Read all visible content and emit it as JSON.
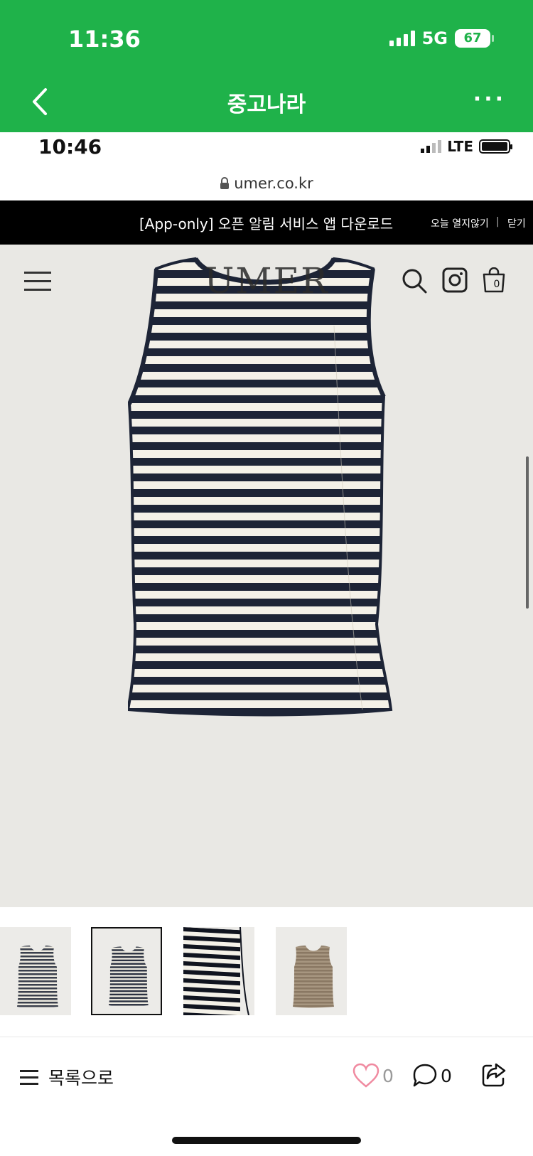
{
  "outer_status": {
    "time": "11:36",
    "network": "5G",
    "battery": "67"
  },
  "app_bar": {
    "title": "중고나라",
    "more": "···"
  },
  "inner_status": {
    "time": "10:46",
    "network": "LTE"
  },
  "browser": {
    "url": "umer.co.kr"
  },
  "promo": {
    "text": "[App-only] 오픈 알림 서비스 앱 다운로드",
    "dont_show_today": "오늘 열지않기",
    "separator": "|",
    "close": "닫기"
  },
  "site": {
    "logo": "UMER",
    "cart_count": "0"
  },
  "product": {
    "main_image": "striped-sleeveless-tank-top",
    "thumbnails": [
      "navy-stripe-tank-front",
      "navy-stripe-tank-front-selected",
      "navy-stripe-fabric-detail",
      "brown-stripe-tank-front"
    ],
    "selected_thumbnail_index": 1
  },
  "bottom_bar": {
    "list_label": "목록으로",
    "like_count": "0",
    "comment_count": "0"
  },
  "colors": {
    "brand_green": "#1fb24a",
    "stripe_navy": "#1d2436",
    "stripe_cream": "#f4f1e8",
    "hero_bg": "#e9e8e4",
    "heart_pink": "#f08aa0"
  },
  "icons": [
    "back-icon",
    "more-icon",
    "lock-icon",
    "hamburger-icon",
    "search-icon",
    "instagram-icon",
    "cart-icon",
    "list-icon",
    "heart-icon",
    "chat-icon",
    "share-icon"
  ]
}
